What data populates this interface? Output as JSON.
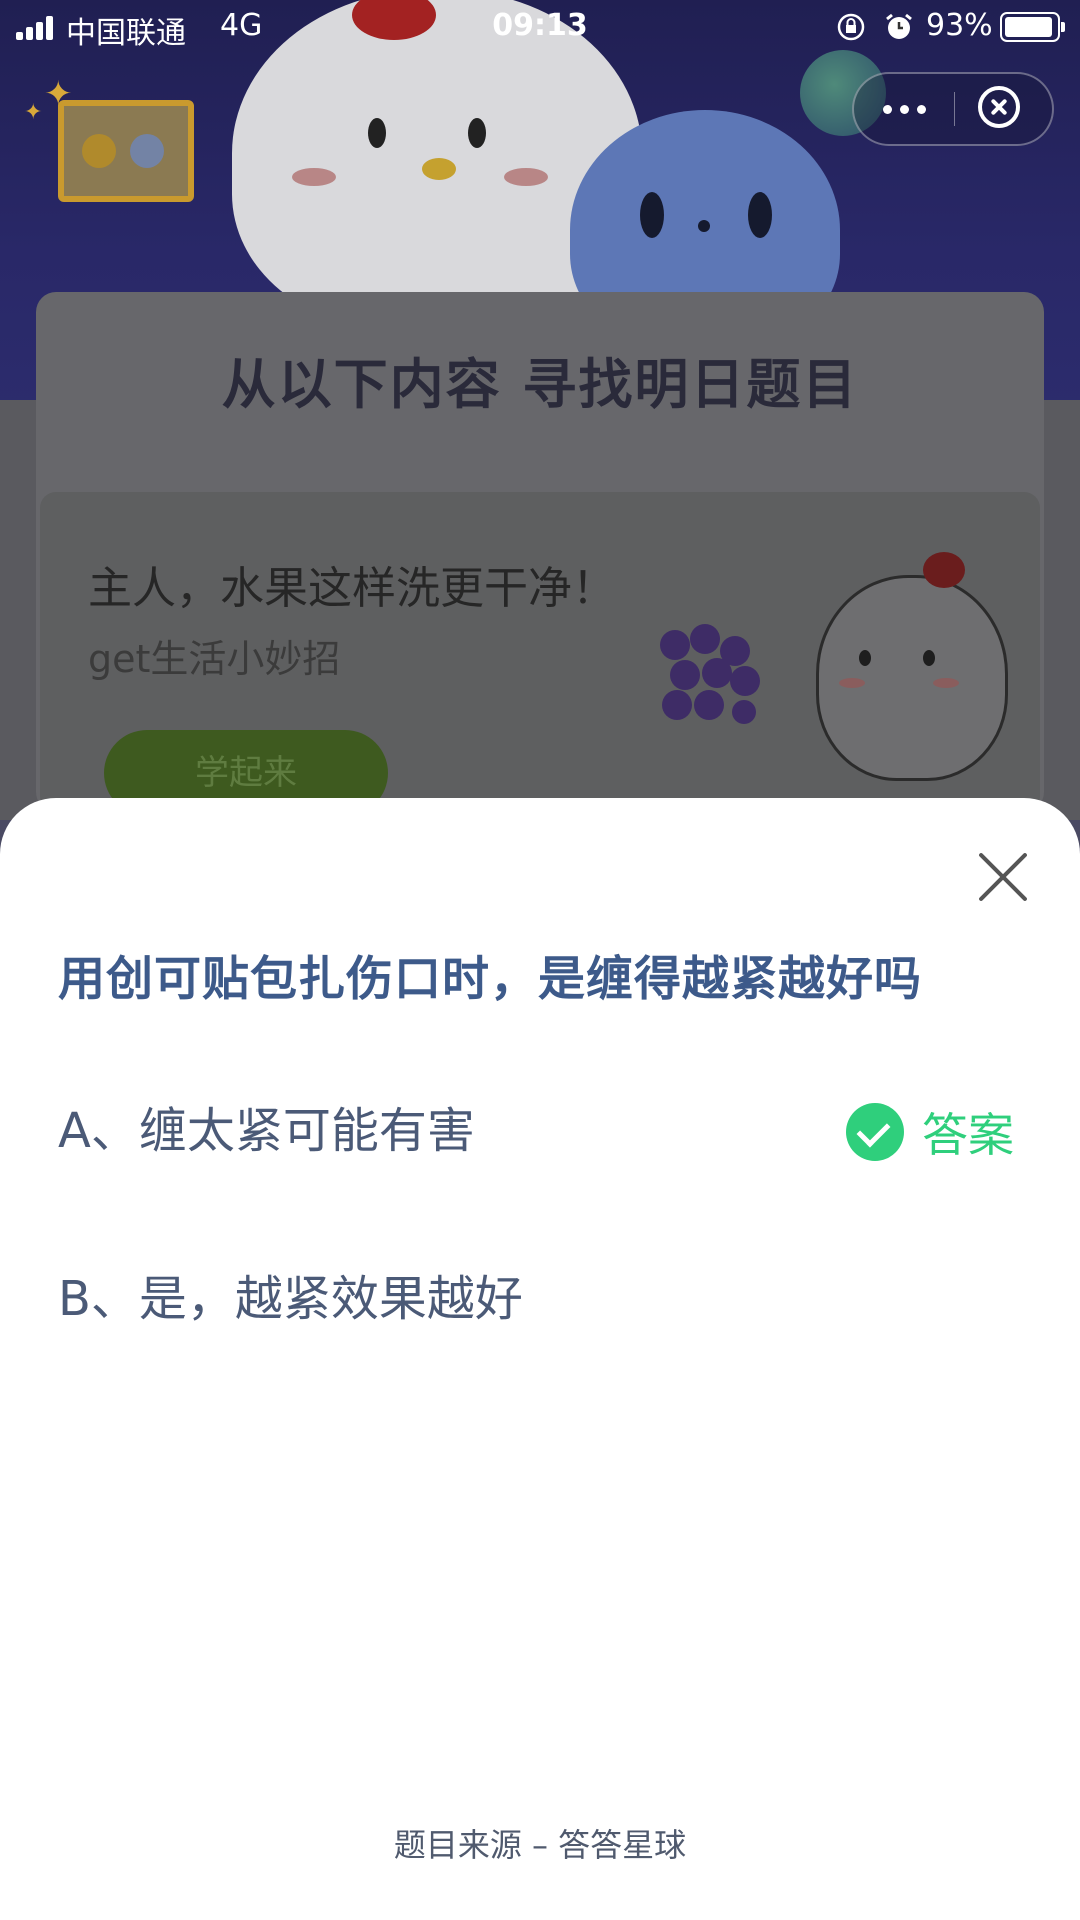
{
  "status_bar": {
    "carrier": "中国联通",
    "network": "4G",
    "time": "09:13",
    "battery_percent": "93%",
    "battery_level": 0.93
  },
  "background": {
    "card_title": "从以下内容  寻找明日题目",
    "headline": "主人，水果这样洗更干净！",
    "subtitle": "get生活小妙招",
    "button_label": "学起来"
  },
  "quiz": {
    "question": "用创可贴包扎伤口时，是缠得越紧越好吗",
    "options": [
      {
        "label": "A、缠太紧可能有害",
        "is_answer": true
      },
      {
        "label": "B、是，越紧效果越好",
        "is_answer": false
      }
    ],
    "answer_label": "答案",
    "source": "题目来源 – 答答星球"
  },
  "colors": {
    "question": "#3d5a8a",
    "answer_green": "#2fcf7c",
    "option_text": "#4b5a77"
  }
}
